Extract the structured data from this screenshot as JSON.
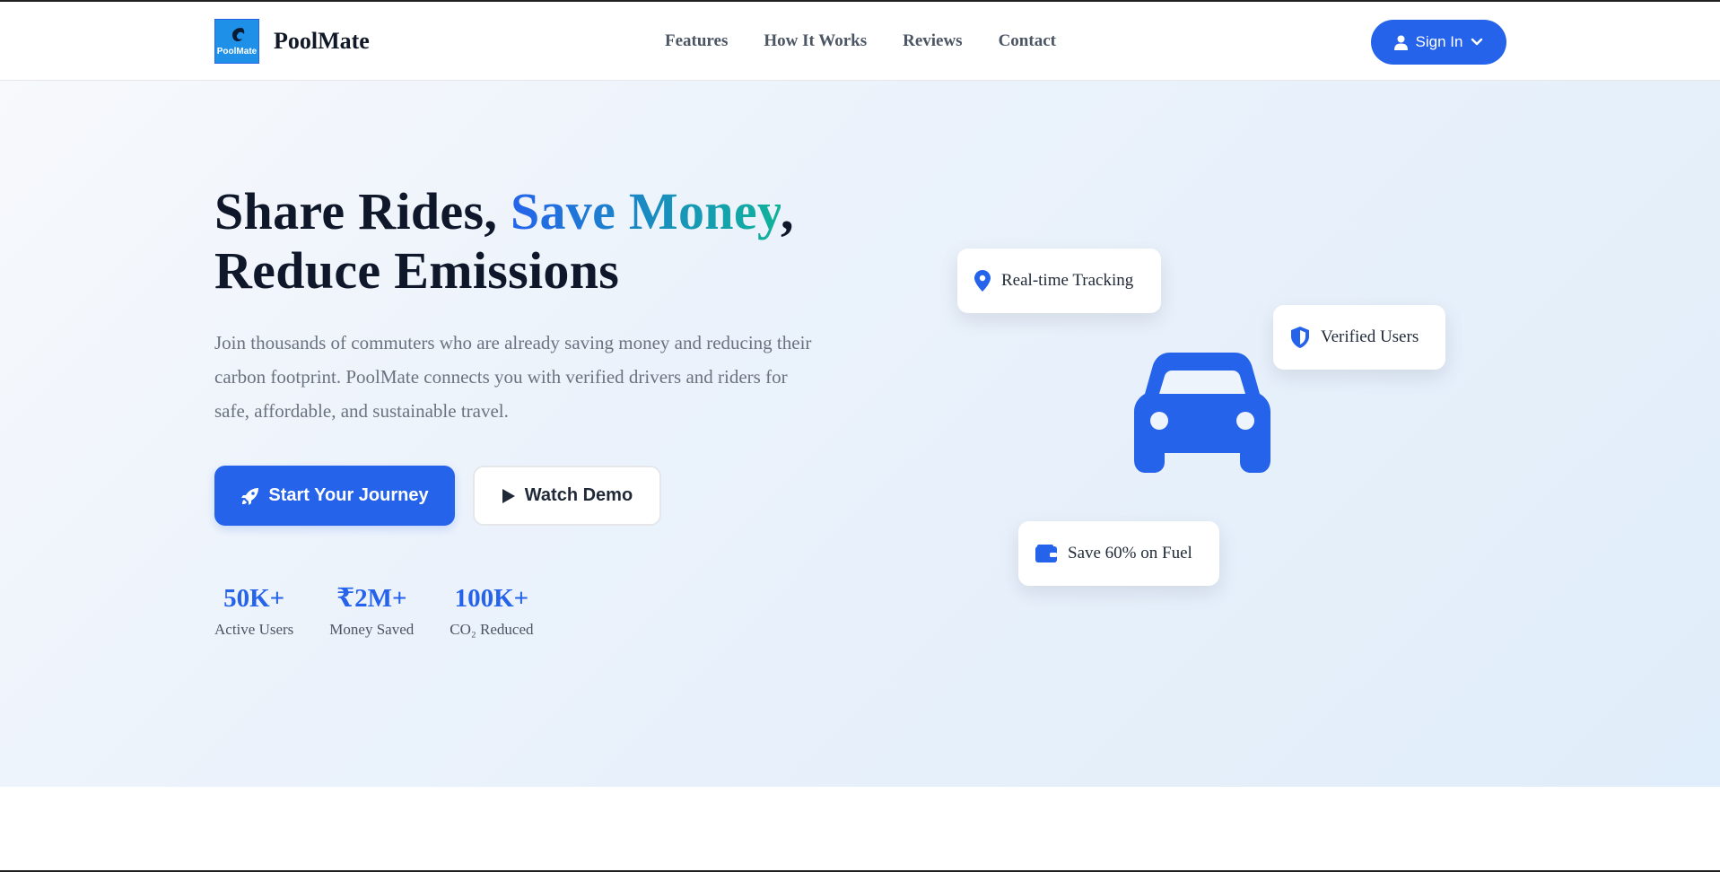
{
  "brand": {
    "logo_text": "PoolMate",
    "name": "PoolMate",
    "logo_color": "#1e90e8"
  },
  "nav": {
    "links": [
      {
        "label": "Features"
      },
      {
        "label": "How It Works"
      },
      {
        "label": "Reviews"
      },
      {
        "label": "Contact"
      }
    ],
    "signin": {
      "label": "Sign In",
      "icon": "user-icon",
      "caret": "chevron-down-icon"
    }
  },
  "hero": {
    "title_part1": "Share Rides, ",
    "title_highlight": "Save Money",
    "title_part2": ",",
    "title_line2": "Reduce Emissions",
    "description": "Join thousands of commuters who are already saving money and reducing their carbon footprint. PoolMate connects you with verified drivers and riders for safe, affordable, and sustainable travel.",
    "primary_button": {
      "label": "Start Your Journey",
      "icon": "rocket-icon"
    },
    "secondary_button": {
      "label": "Watch Demo",
      "icon": "play-icon"
    },
    "stats": [
      {
        "value": "50K+",
        "label": "Active Users"
      },
      {
        "value": "₹2M+",
        "label": "Money Saved"
      },
      {
        "value": "100K+",
        "label": "CO₂ Reduced"
      }
    ]
  },
  "illustration": {
    "main_icon": "car-icon",
    "cards": [
      {
        "label": "Real-time Tracking",
        "icon": "map-pin-icon"
      },
      {
        "label": "Verified Users",
        "icon": "shield-icon"
      },
      {
        "label": "Save 60% on Fuel",
        "icon": "wallet-icon"
      }
    ]
  },
  "colors": {
    "accent": "#2563eb",
    "gradient_end": "#10b39a",
    "heading": "#0f172a",
    "muted_text": "#6b7280"
  }
}
